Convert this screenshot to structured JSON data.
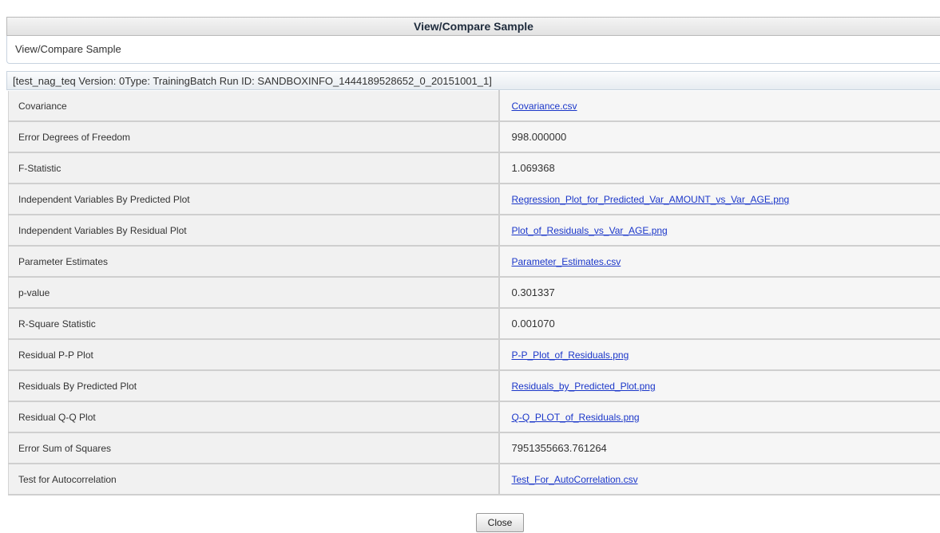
{
  "dialog": {
    "title": "View/Compare Sample",
    "subtitle": "View/Compare Sample",
    "run_header": "[test_nag_teq Version: 0Type: TrainingBatch Run ID: SANDBOXINFO_1444189528652_0_20151001_1]"
  },
  "rows": [
    {
      "name": "Covariance",
      "value": "Covariance.csv",
      "is_link": true
    },
    {
      "name": "Error Degrees of Freedom",
      "value": "998.000000",
      "is_link": false
    },
    {
      "name": "F-Statistic",
      "value": "1.069368",
      "is_link": false
    },
    {
      "name": "Independent Variables By Predicted Plot",
      "value": "Regression_Plot_for_Predicted_Var_AMOUNT_vs_Var_AGE.png",
      "is_link": true
    },
    {
      "name": "Independent Variables By Residual Plot",
      "value": "Plot_of_Residuals_vs_Var_AGE.png",
      "is_link": true
    },
    {
      "name": "Parameter Estimates",
      "value": "Parameter_Estimates.csv",
      "is_link": true
    },
    {
      "name": "p-value",
      "value": "0.301337",
      "is_link": false
    },
    {
      "name": "R-Square Statistic",
      "value": "0.001070",
      "is_link": false
    },
    {
      "name": "Residual P-P Plot",
      "value": "P-P_Plot_of_Residuals.png",
      "is_link": true
    },
    {
      "name": "Residuals By Predicted Plot",
      "value": "Residuals_by_Predicted_Plot.png",
      "is_link": true
    },
    {
      "name": "Residual Q-Q Plot",
      "value": "Q-Q_PLOT_of_Residuals.png",
      "is_link": true
    },
    {
      "name": "Error Sum of Squares",
      "value": "7951355663.761264",
      "is_link": false
    },
    {
      "name": "Test for Autocorrelation",
      "value": "Test_For_AutoCorrelation.csv",
      "is_link": true
    }
  ],
  "buttons": {
    "close_label": "Close"
  },
  "colors": {
    "link": "#1a36c9",
    "header_text": "#1e2b3c"
  }
}
